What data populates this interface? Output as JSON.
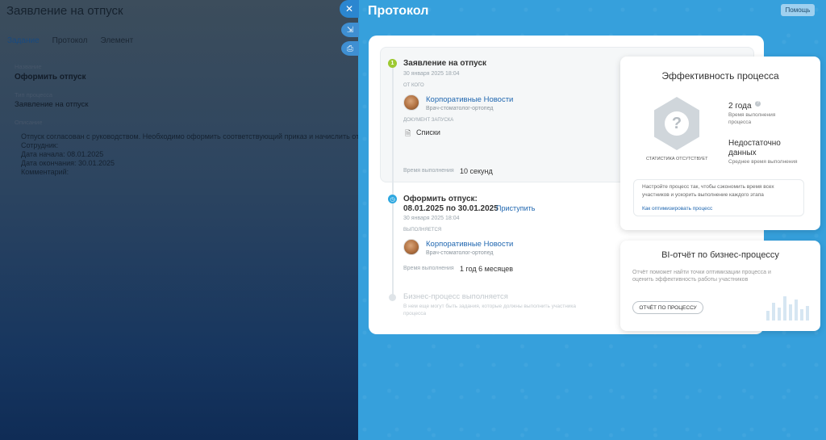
{
  "left_panel": {
    "title": "Заявление на отпуск",
    "tabs": [
      "Задание",
      "Протокол",
      "Элемент"
    ],
    "name_label": "Название",
    "name_value": "Оформить отпуск",
    "type_label": "Тип процесса",
    "type_value": "Заявление на отпуск",
    "desc_label": "Описание",
    "desc_lines": [
      "Отпуск согласован с руководством. Необходимо оформить соответствующий приказ и начислить отпуск",
      "Сотрудник:",
      "Дата начала: 08.01.2025",
      "Дата окончания: 30.01.2025",
      "Комментарий:"
    ]
  },
  "controls": {
    "close": "✕",
    "expand": "⇲",
    "print": "⎙"
  },
  "protocol": {
    "title": "Протокол",
    "help_button": "Помощь",
    "step1": {
      "number": "1",
      "title": "Заявление на отпуск",
      "date": "30 января 2025 18:04",
      "from_caption": "ОТ КОГО",
      "user_name": "Корпоративные Новости",
      "user_role": "Врач-стоматолог-ортопед",
      "doc_caption": "ДОКУМЕНТ ЗАПУСКА",
      "doc_name": "Списки",
      "exec_time_label": "Время выполнения",
      "exec_time_value": "10 секунд"
    },
    "step2": {
      "title_line1": "Оформить отпуск:",
      "title_line2": "08.01.2025 по 30.01.2025",
      "action_link": "Приступить",
      "date": "30 января 2025 18:04",
      "performer_caption": "ВЫПОЛНЯЕТСЯ",
      "user_name": "Корпоративные Новости",
      "user_role": "Врач-стоматолог-ортопед",
      "exec_time_label": "Время выполнения",
      "exec_time_value": "1 год 6 месяцев"
    },
    "step3": {
      "title": "Бизнес-процесс выполняется",
      "note_line1": "В нем еще могут быть задания, которые должны выполнить участника",
      "note_line2": "процесса"
    }
  },
  "efficiency": {
    "title": "Эффективность процесса",
    "hex_symbol": "?",
    "no_stats": "СТАТИСТИКА ОТСУТСТВУЕТ",
    "duration_value": "2 года",
    "duration_label_1": "Время выполнения",
    "duration_label_2": "процесса",
    "avg_value_1": "Недостаточно",
    "avg_value_2": "данных",
    "avg_label": "Среднее время выполнения",
    "tip_line1": "Настройте процесс так, чтобы сэкономить время всех",
    "tip_line2": "участников и ускорить выполнение каждого этапа",
    "tip_link": "Как оптимизировать процесс"
  },
  "bi_report": {
    "title": "BI-отчёт по бизнес-процессу",
    "text_line1": "Отчёт поможет найти точки оптимизации процесса и",
    "text_line2": "оценить эффективность работы участников",
    "button": "ОТЧЁТ ПО ПРОЦЕССУ"
  },
  "colors": {
    "accent": "#2067b0",
    "blue_bg": "#36a0dc",
    "step_done": "#9dc931",
    "step_active": "#2fa8e0"
  }
}
